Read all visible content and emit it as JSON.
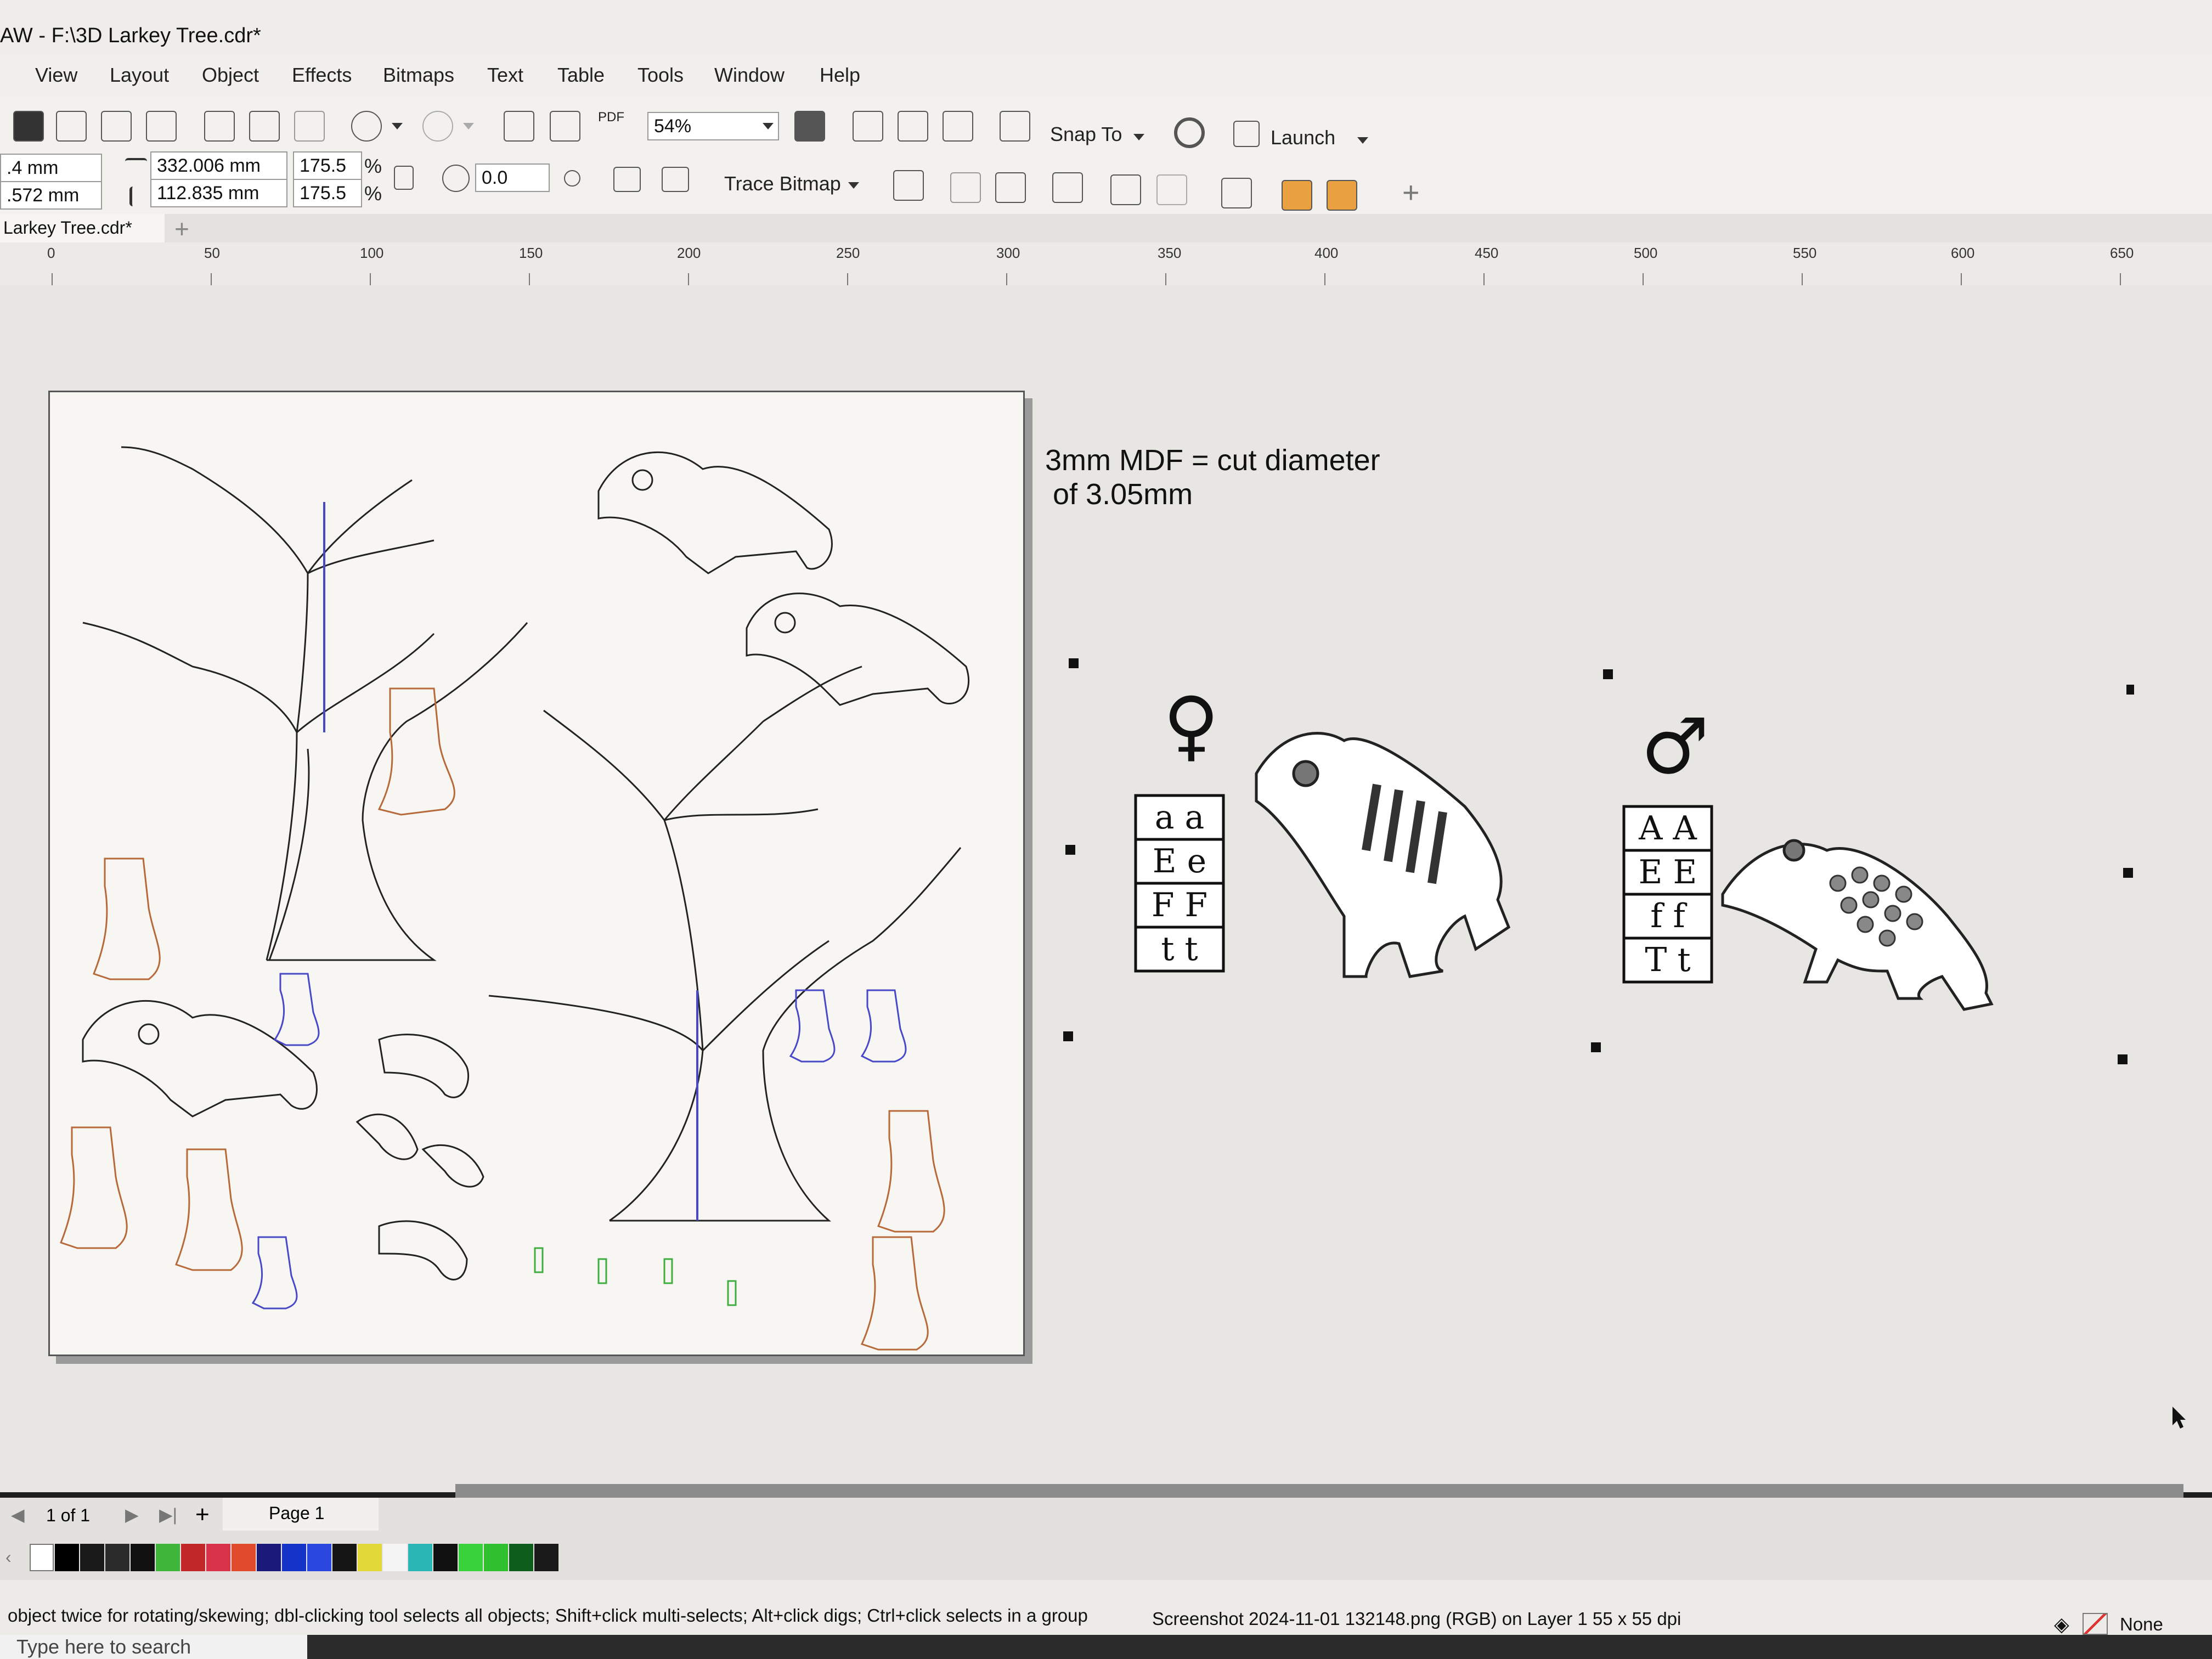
{
  "window": {
    "title": "AW - F:\\3D Larkey Tree.cdr*"
  },
  "menu": [
    "View",
    "Layout",
    "Object",
    "Effects",
    "Bitmaps",
    "Text",
    "Table",
    "Tools",
    "Window",
    "Help"
  ],
  "toolbar": {
    "zoom": "54%",
    "snap_label": "Snap To",
    "launch_label": "Launch",
    "pdf_label": "PDF"
  },
  "property_bar": {
    "pos_x": ".4 mm",
    "pos_y": ".572 mm",
    "width": "332.006 mm",
    "height": "112.835 mm",
    "scale_x": "175.5",
    "scale_y": "175.5",
    "percent": "%",
    "rotation": "0.0",
    "trace_bitmap_label": "Trace Bitmap"
  },
  "document_tab": {
    "label": "Larkey Tree.cdr*"
  },
  "ruler": [
    "0",
    "50",
    "100",
    "150",
    "200",
    "250",
    "300",
    "350",
    "400",
    "450",
    "500",
    "550",
    "600",
    "650"
  ],
  "canvas": {
    "note_line1": "3mm MDF = cut diameter",
    "note_line2": "of 3.05mm",
    "female_symbol": "♀",
    "male_symbol": "♂",
    "female_genotype": [
      "a a",
      "E e",
      "F F",
      "t t"
    ],
    "male_genotype": [
      "A A",
      "E E",
      "f f",
      "T t"
    ]
  },
  "page_nav": {
    "counter": "1 of 1",
    "page_tab": "Page 1"
  },
  "palette": [
    "#000000",
    "#1a1a1a",
    "#2b2b2b",
    "#111111",
    "#3fb53a",
    "#c2282a",
    "#d8334a",
    "#e04a2a",
    "#1a1a7a",
    "#1533c8",
    "#2a48e0",
    "#151515",
    "#e2d83a",
    "#f4f4f4",
    "#2cb7b7",
    "#101010",
    "#3ad23a",
    "#2fbf2f",
    "#0d5e1d",
    "#1a1a1a"
  ],
  "status": {
    "hint": "object twice for rotating/skewing; dbl-clicking tool selects all objects; Shift+click multi-selects; Alt+click digs; Ctrl+click selects in a group",
    "object_info": "Screenshot 2024-11-01 132148.png (RGB) on Layer 1  55 x 55 dpi",
    "fill": "None"
  },
  "taskbar": {
    "search_placeholder": "Type here to search"
  }
}
